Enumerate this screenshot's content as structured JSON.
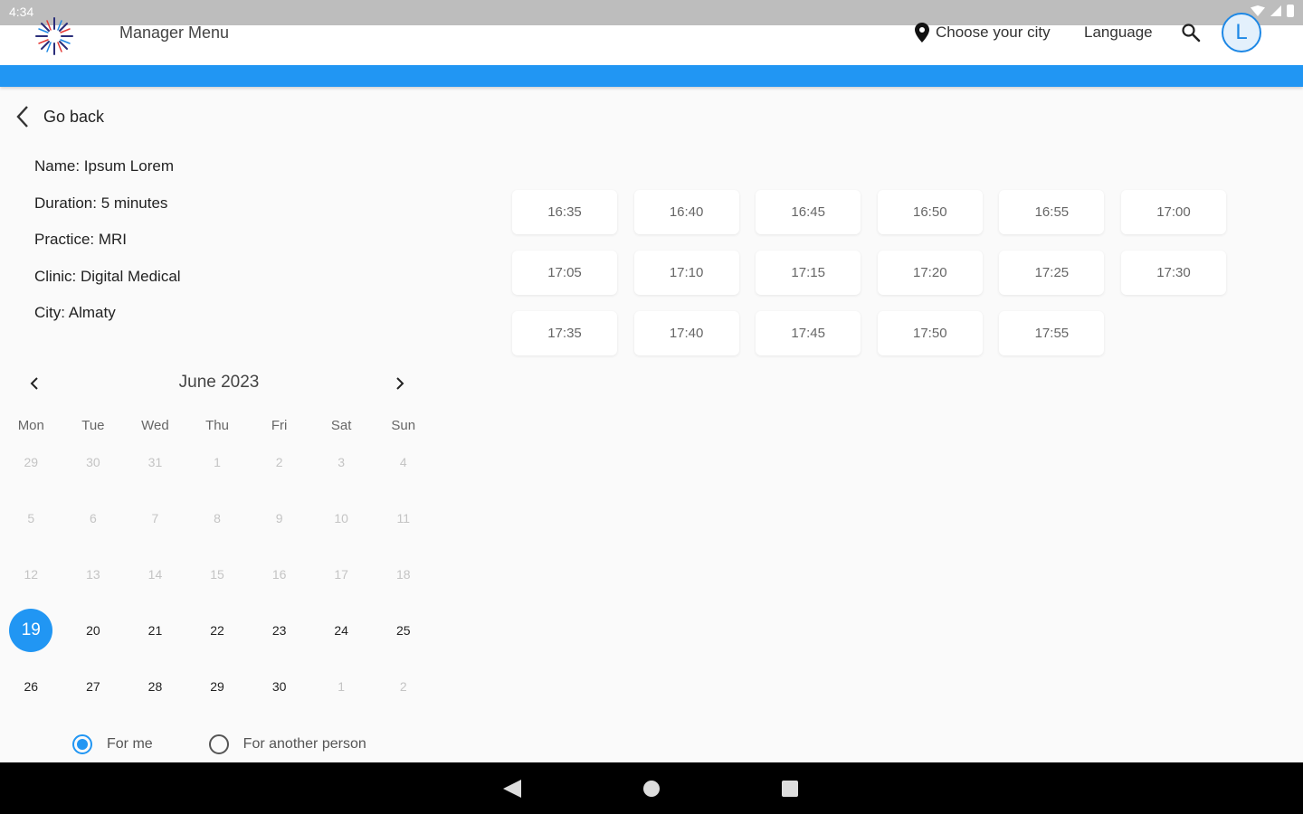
{
  "status_bar": {
    "time": "4:34"
  },
  "header": {
    "title": "Manager Menu",
    "city_label": "Choose your city",
    "language_label": "Language",
    "avatar_letter": "L"
  },
  "go_back_label": "Go back",
  "info": {
    "name": "Name: Ipsum Lorem",
    "duration": "Duration: 5 minutes",
    "practice": "Practice: MRI",
    "clinic": "Clinic: Digital Medical",
    "city": "City: Almaty"
  },
  "calendar": {
    "title": "June 2023",
    "weekdays": [
      "Mon",
      "Tue",
      "Wed",
      "Thu",
      "Fri",
      "Sat",
      "Sun"
    ],
    "selected_day": "19",
    "weeks": [
      [
        "29",
        "30",
        "31",
        "1",
        "2",
        "3",
        "4"
      ],
      [
        "5",
        "6",
        "7",
        "8",
        "9",
        "10",
        "11"
      ],
      [
        "12",
        "13",
        "14",
        "15",
        "16",
        "17",
        "18"
      ],
      [
        "19",
        "20",
        "21",
        "22",
        "23",
        "24",
        "25"
      ],
      [
        "26",
        "27",
        "28",
        "29",
        "30",
        "1",
        "2"
      ]
    ]
  },
  "radios": {
    "for_me": "For me",
    "for_another": "For another person",
    "selected": "for_me"
  },
  "time_slots": [
    "16:35",
    "16:40",
    "16:45",
    "16:50",
    "16:55",
    "17:00",
    "17:05",
    "17:10",
    "17:15",
    "17:20",
    "17:25",
    "17:30",
    "17:35",
    "17:40",
    "17:45",
    "17:50",
    "17:55"
  ],
  "colors": {
    "accent": "#2196f3",
    "header_bg": "#ffffff",
    "page_bg": "#fafafa"
  }
}
